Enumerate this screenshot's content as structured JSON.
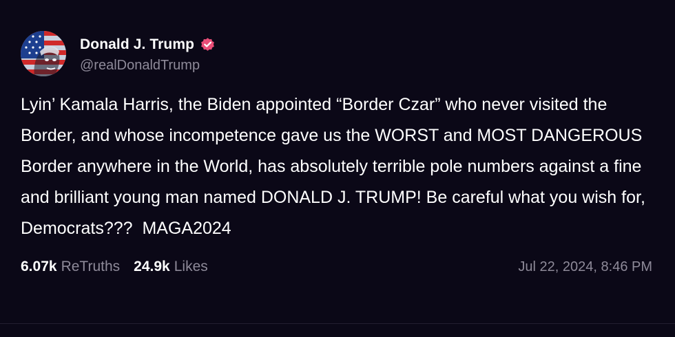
{
  "author": {
    "display_name": "Donald J. Trump",
    "handle": "@realDonaldTrump",
    "verified": true,
    "avatar_icon": "flag-portrait-avatar"
  },
  "post": {
    "text": "Lyin’ Kamala Harris, the Biden appointed “Border Czar” who never visited the Border, and whose incompetence gave us the WORST and MOST DANGEROUS Border anywhere in the World, has absolutely terrible pole numbers against a fine and brilliant young man named DONALD J. TRUMP! Be careful what you wish for, Democrats???  MAGA2024",
    "timestamp": "Jul 22, 2024, 8:46 PM"
  },
  "stats": {
    "retruths_count": "6.07k",
    "retruths_label": "ReTruths",
    "likes_count": "24.9k",
    "likes_label": "Likes"
  },
  "colors": {
    "background": "#0b0817",
    "text": "#ffffff",
    "muted": "#8e8a99",
    "verified_badge": "#e94e77"
  }
}
